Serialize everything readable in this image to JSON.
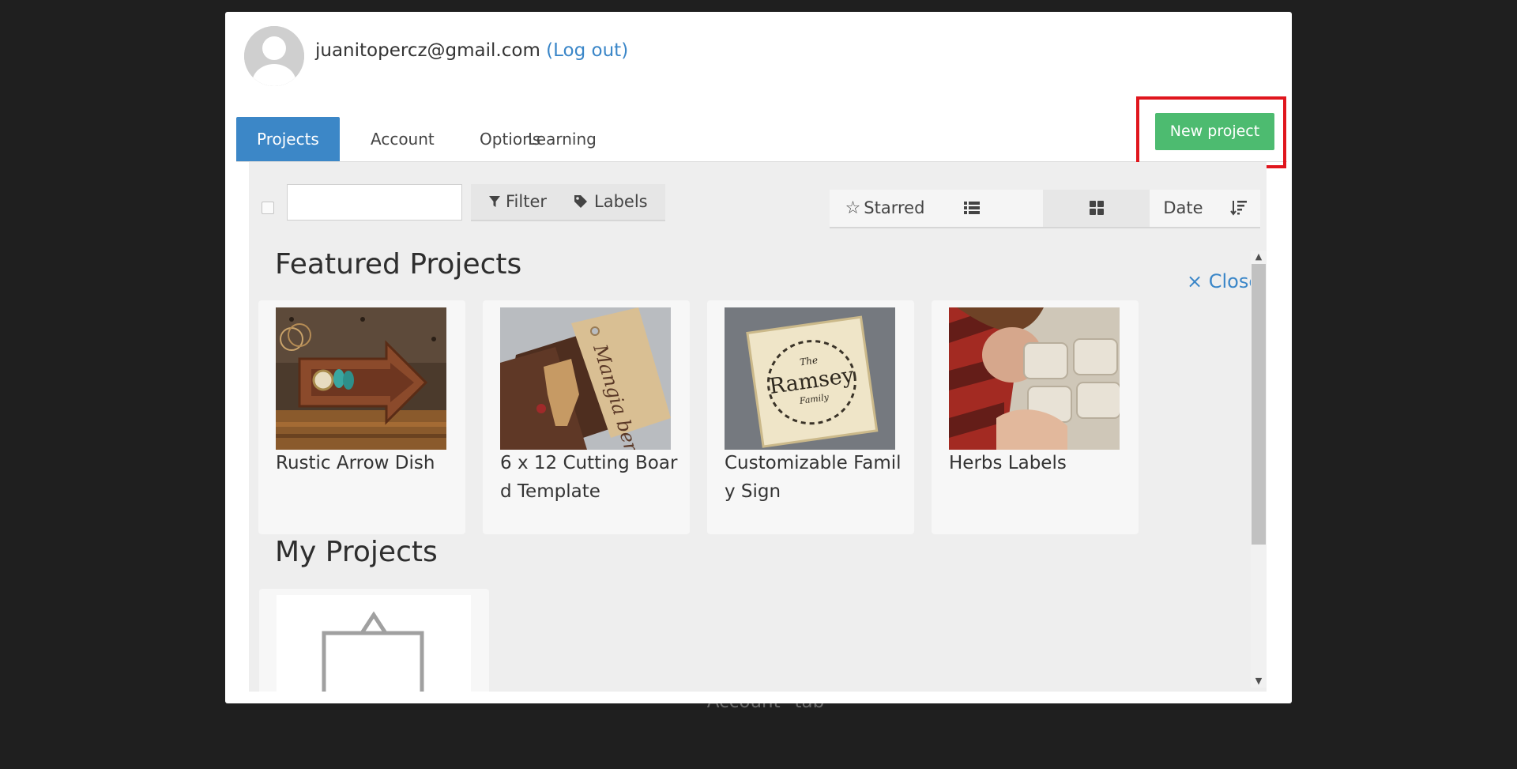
{
  "backdrop": {
    "text": "Account \"tab"
  },
  "user": {
    "email": "juanitopercz@gmail.com",
    "logout_label": "(Log out)"
  },
  "tabs": [
    {
      "label": "Projects",
      "active": true
    },
    {
      "label": "Account"
    },
    {
      "label": "Options"
    },
    {
      "label": "Learning"
    }
  ],
  "new_project": {
    "label": "New project"
  },
  "toolbar": {
    "search_value": "",
    "filter_label": "Filter",
    "labels_label": "Labels",
    "starred_label": "Starred",
    "sort_label": "Date"
  },
  "featured": {
    "title": "Featured Projects",
    "close_label": "× Close",
    "projects": [
      {
        "title": "Rustic Arrow Dish"
      },
      {
        "title": "6 x 12 Cutting Board Template"
      },
      {
        "title": "Customizable Family Sign"
      },
      {
        "title": "Herbs Labels"
      }
    ],
    "thumb_texts": {
      "cutting_board": "Mangia bene",
      "sign_small": "The",
      "sign_name": "Ramsey",
      "sign_family": "Family"
    }
  },
  "my_projects": {
    "title": "My Projects"
  },
  "colors": {
    "accent": "#3c87c7",
    "new_project": "#4dbb70",
    "highlight": "#e0161d",
    "link": "#3a86c8"
  }
}
